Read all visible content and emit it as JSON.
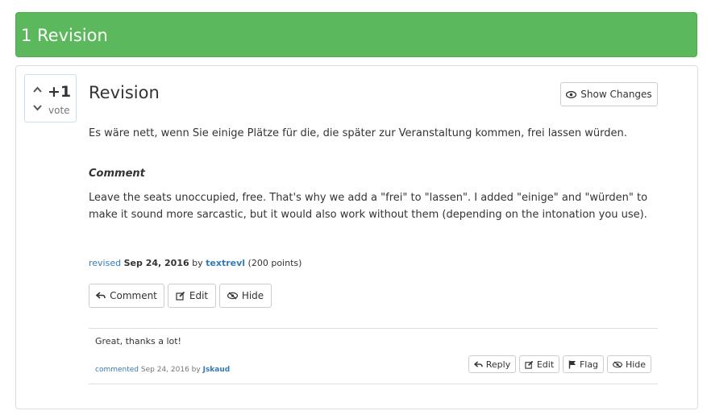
{
  "header": {
    "title": "1 Revision"
  },
  "vote": {
    "count": "+1",
    "label": "vote"
  },
  "revision": {
    "title": "Revision",
    "show_changes_label": "Show Changes",
    "body": "Es wäre nett, wenn Sie einige Plätze für die, die später zur Veranstaltung kommen, frei lassen würden.",
    "comment_heading": "Comment",
    "comment_text": "Leave the seats unoccupied, free. That's why we add a \"frei\" to \"lassen\". I added \"einige\" and \"würden\" to make it sound more sarcastic, but it would also work without them (depending on the intonation you use).",
    "meta": {
      "action": "revised",
      "date": "Sep 24, 2016",
      "by": "by",
      "user": "textrevl",
      "points": "(200 points)"
    },
    "actions": {
      "comment": "Comment",
      "edit": "Edit",
      "hide": "Hide"
    }
  },
  "comment": {
    "text": "Great, thanks a lot!",
    "meta": {
      "action": "commented",
      "date": "Sep 24, 2016",
      "by": "by",
      "user": "Jskaud"
    },
    "actions": {
      "reply": "Reply",
      "edit": "Edit",
      "flag": "Flag",
      "hide": "Hide"
    }
  },
  "colors": {
    "header_bg": "#5cb85c",
    "link": "#337ab7",
    "border": "#cccccc"
  }
}
